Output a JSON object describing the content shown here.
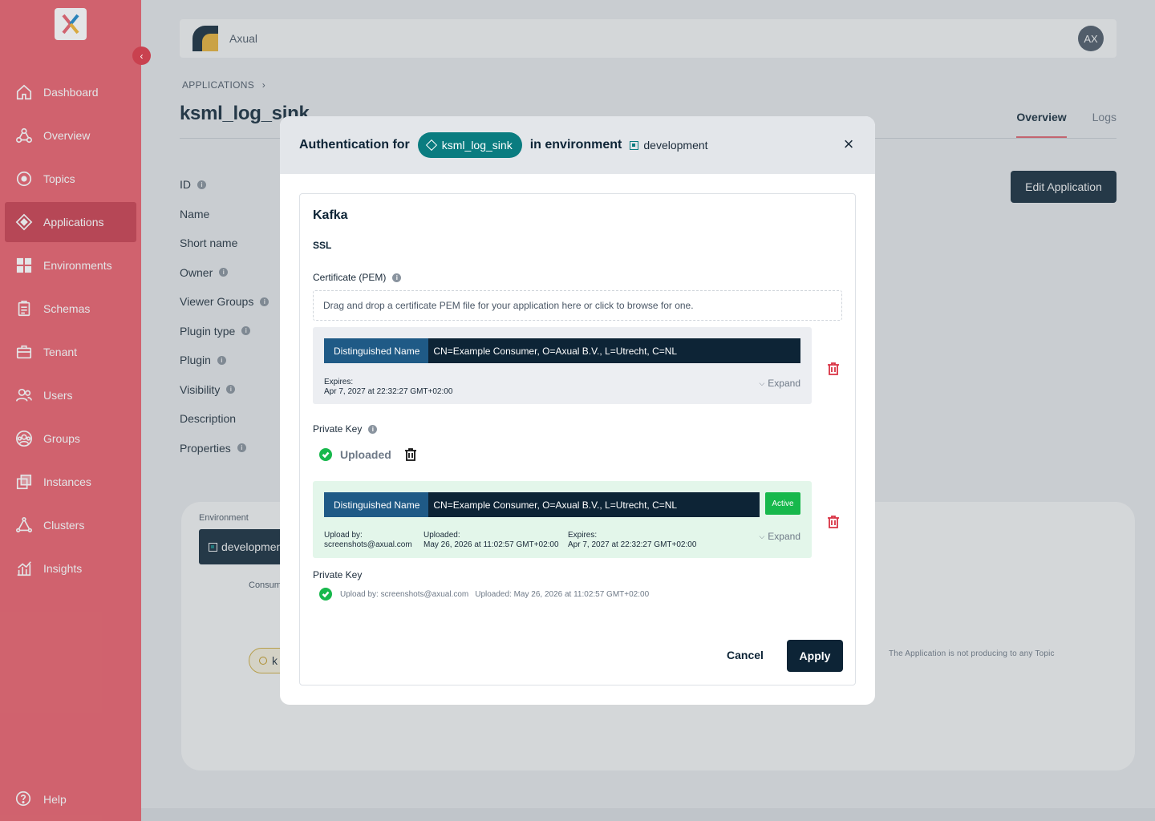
{
  "sidebar": {
    "collapse_glyph": "‹",
    "items": [
      {
        "label": "Dashboard",
        "icon": "home-icon"
      },
      {
        "label": "Overview",
        "icon": "overview-icon"
      },
      {
        "label": "Topics",
        "icon": "topic-icon"
      },
      {
        "label": "Applications",
        "icon": "application-icon"
      },
      {
        "label": "Environments",
        "icon": "environments-icon"
      },
      {
        "label": "Schemas",
        "icon": "schema-icon"
      },
      {
        "label": "Tenant",
        "icon": "tenant-icon"
      },
      {
        "label": "Users",
        "icon": "users-icon"
      },
      {
        "label": "Groups",
        "icon": "groups-icon"
      },
      {
        "label": "Instances",
        "icon": "instances-icon"
      },
      {
        "label": "Clusters",
        "icon": "clusters-icon"
      },
      {
        "label": "Insights",
        "icon": "insights-icon"
      }
    ],
    "help": "Help",
    "accent": "#e8606c"
  },
  "topbar": {
    "brand": "Axual",
    "avatar": "AX"
  },
  "page": {
    "breadcrumb": "APPLICATIONS",
    "breadcrumb_sep": "›",
    "title": "ksml_log_sink",
    "tabs": {
      "overview": "Overview",
      "logs": "Logs"
    },
    "edit_button": "Edit Application",
    "props": {
      "id": "ID",
      "name": "Name",
      "short_name": "Short name",
      "owner": "Owner",
      "viewer_groups": "Viewer Groups",
      "plugin_type": "Plugin type",
      "plugin": "Plugin",
      "visibility": "Visibility",
      "description": "Description",
      "properties": "Properties"
    },
    "info_glyph": "i",
    "env_card": {
      "label": "Environment",
      "chip": "developmen",
      "consumes": "Consum",
      "k_chip": "k",
      "not_producing": "The Application is not producing to any Topic"
    }
  },
  "modal": {
    "title_prefix": "Authentication for",
    "app_chip": "ksml_log_sink",
    "in_env": "in environment",
    "env_name": "development",
    "close_glyph": "×",
    "section": "Kafka",
    "protocol": "SSL",
    "cert_label": "Certificate (PEM)",
    "dropzone": "Drag and drop a certificate PEM file for your application here or click to browse for one.",
    "new_cert": {
      "dn_label": "Distinguished Name",
      "dn_value": "CN=Example Consumer, O=Axual B.V., L=Utrecht, C=NL",
      "expires_label": "Expires:",
      "expires_value": "Apr 7, 2027 at 22:32:27 GMT+02:00",
      "expand": "Expand"
    },
    "private_key_label": "Private Key",
    "uploaded": "Uploaded",
    "active_cert": {
      "dn_label": "Distinguished Name",
      "dn_value": "CN=Example Consumer, O=Axual B.V., L=Utrecht, C=NL",
      "badge": "Active",
      "upload_by_label": "Upload by:",
      "upload_by_value": "screenshots@axual.com",
      "uploaded_label": "Uploaded:",
      "uploaded_value": "May 26, 2026 at 11:02:57 GMT+02:00",
      "expires_label": "Expires:",
      "expires_value": "Apr 7, 2027 at 22:32:27 GMT+02:00",
      "expand": "Expand"
    },
    "private_key2_label": "Private Key",
    "pk2_upload_by": "Upload by: screenshots@axual.com",
    "pk2_uploaded": "Uploaded: May 26, 2026 at 11:02:57 GMT+02:00",
    "cancel": "Cancel",
    "apply": "Apply"
  }
}
